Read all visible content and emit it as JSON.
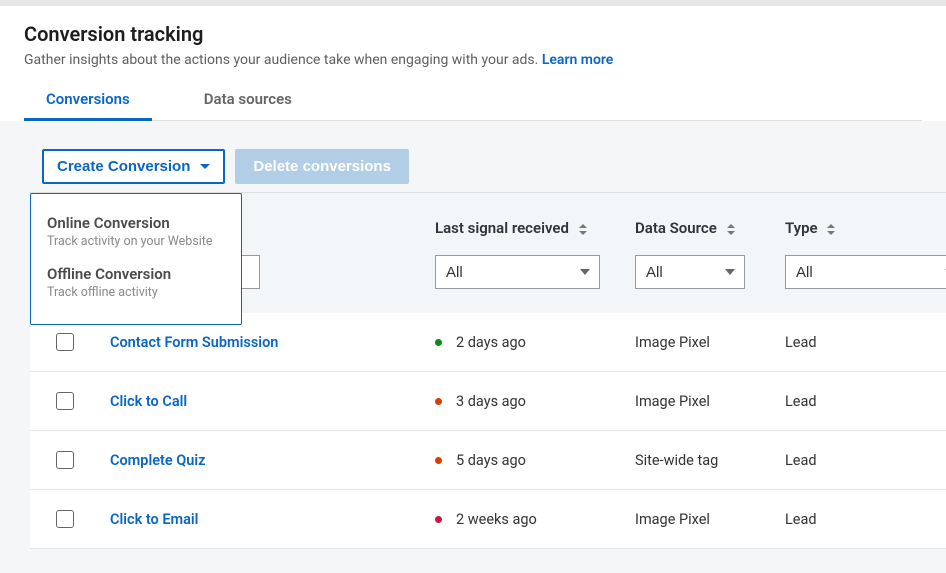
{
  "header": {
    "title": "Conversion tracking",
    "subtitle": "Gather insights about the actions your audience take when engaging with your ads.",
    "learn_more": "Learn more"
  },
  "tabs": [
    {
      "label": "Conversions",
      "active": true
    },
    {
      "label": "Data sources",
      "active": false
    }
  ],
  "actions": {
    "create_label": "Create Conversion",
    "delete_label": "Delete conversions",
    "dropdown": [
      {
        "title": "Online Conversion",
        "sub": "Track activity on your Website"
      },
      {
        "title": "Offline Conversion",
        "sub": "Track offline activity"
      }
    ]
  },
  "columns": {
    "signal": "Last signal received",
    "data_source": "Data Source",
    "type": "Type"
  },
  "filters": {
    "signal_value": "All",
    "data_source_value": "All",
    "type_value": "All"
  },
  "rows": [
    {
      "name": "Contact Form Submission",
      "signal": "2 days ago",
      "dot": "green",
      "source": "Image Pixel",
      "type": "Lead"
    },
    {
      "name": "Click to Call",
      "signal": "3 days ago",
      "dot": "orange",
      "source": "Image Pixel",
      "type": "Lead"
    },
    {
      "name": "Complete Quiz",
      "signal": "5 days ago",
      "dot": "orange",
      "source": "Site-wide tag",
      "type": "Lead"
    },
    {
      "name": "Click to Email",
      "signal": "2 weeks ago",
      "dot": "red",
      "source": "Image Pixel",
      "type": "Lead"
    }
  ]
}
